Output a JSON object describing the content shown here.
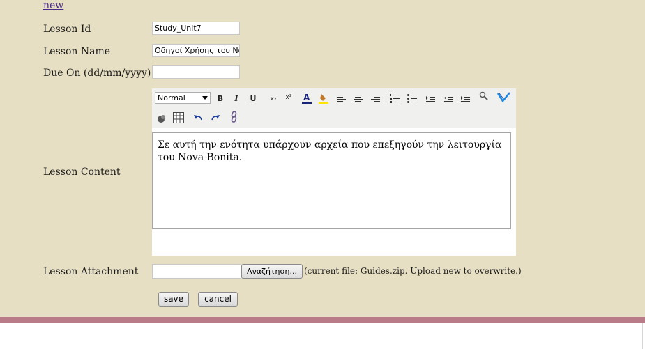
{
  "nav": {
    "new_link": "new"
  },
  "form": {
    "lesson_id": {
      "label": "Lesson Id",
      "value": "Study_Unit7"
    },
    "lesson_name": {
      "label": "Lesson Name",
      "value": "Οδηγοί Χρήσης του Nova Bonita"
    },
    "due_on": {
      "label": "Due On (dd/mm/yyyy)",
      "value": ""
    },
    "lesson_content": {
      "label": "Lesson Content",
      "format_selected": "Normal",
      "text": "Σε αυτή την ενότητα υπάρχουν αρχεία που επεξηγούν την λειτουργία του Nova Bonita."
    },
    "lesson_attachment": {
      "label": "Lesson Attachment",
      "browse_label": "Αναζήτηση...",
      "note": "(current file: Guides.zip. Upload new to overwrite.)"
    },
    "save_label": "save",
    "cancel_label": "cancel"
  },
  "toolbar": {
    "bold": "B",
    "italic": "I",
    "underline": "U",
    "subscript": "x₂",
    "superscript": "x²",
    "icons": [
      "font-color-icon",
      "highlight-icon",
      "align-left-icon",
      "align-center-icon",
      "align-right-icon",
      "ordered-list-icon",
      "unordered-list-icon",
      "indent-icon",
      "outdent-icon",
      "outdent-alt-icon",
      "search-icon",
      "spellcheck-icon",
      "remove-format-icon",
      "table-icon",
      "undo-icon",
      "redo-icon",
      "link-icon"
    ]
  },
  "colors": {
    "background": "#e6dfc3",
    "footer_bar": "#b97b87",
    "link": "#4b2a8c"
  }
}
